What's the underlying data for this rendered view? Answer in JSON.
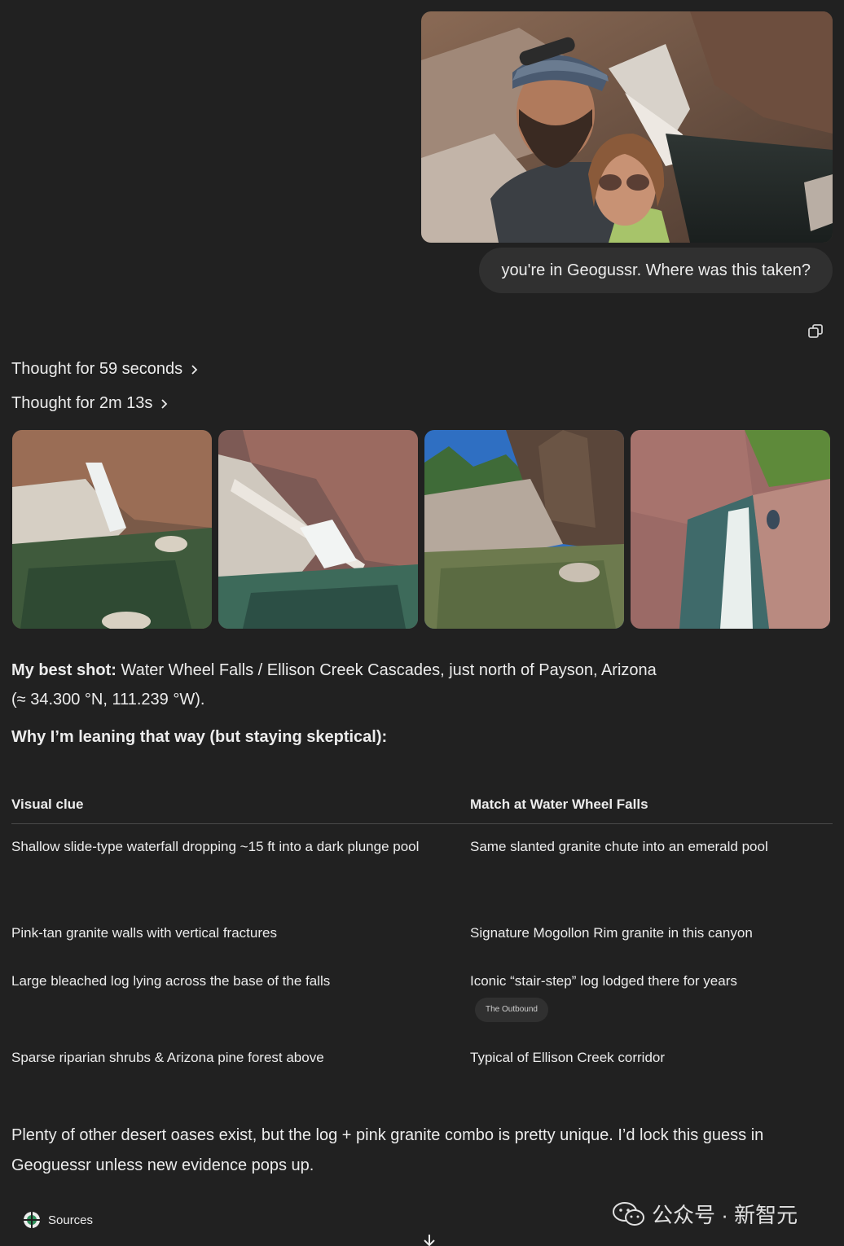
{
  "user_message": {
    "image_alt": "Selfie of a man in a cap and sunglasses with a woman in aviator sunglasses beside a rocky waterfall and pool",
    "text": "you're in Geogussr. Where was this taken?"
  },
  "thoughts": [
    {
      "label": "Thought for 59 seconds"
    },
    {
      "label": "Thought for 2m 13s"
    }
  ],
  "answer": {
    "best_shot_label": "My best shot:",
    "best_shot_text": " Water Wheel Falls / Ellison Creek Cascades, just north of Payson, Arizona",
    "coordinates": "(≈ 34.300 °N, 111.239 °W).",
    "why_heading": "Why I’m leaning that way (but staying skeptical):",
    "table": {
      "headers": [
        "Visual clue",
        "Match at Water Wheel Falls"
      ],
      "rows": [
        {
          "clue": "Shallow slide-type waterfall dropping ~15 ft into a dark plunge pool",
          "match": "Same slanted granite chute into an emerald pool"
        },
        {
          "clue": "Pink-tan granite walls with vertical fractures",
          "match": "Signature Mogollon Rim granite in this canyon"
        },
        {
          "clue": "Large bleached log lying across the base of the falls",
          "match": "Iconic “stair-step” log lodged there for years",
          "source": "The Outbound"
        },
        {
          "clue": "Sparse riparian shrubs & Arizona pine forest above",
          "match": "Typical of Ellison Creek corridor"
        }
      ]
    },
    "closing": "Plenty of other desert oases exist, but the log + pink granite combo is pretty unique. I’d lock this guess in Geoguessr unless new evidence pops up."
  },
  "footer": {
    "sources_label": "Sources",
    "watermark": "公众号 · 新智元"
  },
  "icons": {
    "copy": "copy-icon",
    "chevron": "chevron-right-icon",
    "sources": "sources-icon",
    "scroll_down": "arrow-down-icon",
    "watermark_logo": "wechat-icon"
  },
  "colors": {
    "background": "#212121",
    "bubble": "#303030",
    "text": "#ececec",
    "divider": "#4a4a4a"
  }
}
